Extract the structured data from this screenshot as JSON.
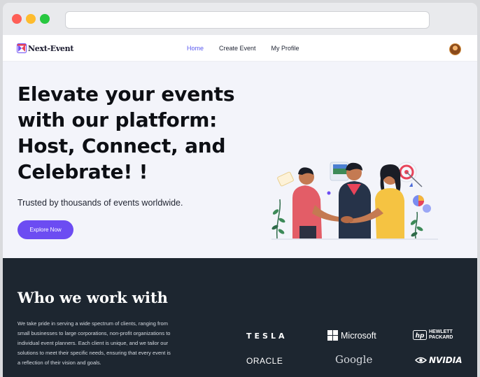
{
  "app": {
    "logo_text": "Next-Event"
  },
  "nav": {
    "items": [
      {
        "label": "Home",
        "active": true
      },
      {
        "label": "Create Event",
        "active": false
      },
      {
        "label": "My Profile",
        "active": false
      }
    ]
  },
  "hero": {
    "title": "Elevate your events with our platform: Host, Connect, and Celebrate! !",
    "subtitle": "Trusted by thousands of events worldwide.",
    "cta_label": "Explore Now"
  },
  "partners": {
    "title": "Who we work with",
    "description": "We take pride in serving a wide spectrum of clients, ranging from small businesses to large corporations, non-profit organizations to individual event planners. Each client is unique, and we tailor our solutions to meet their specific needs, ensuring that every event is a reflection of their vision and goals.",
    "brands": {
      "tesla": "TESLA",
      "microsoft": "Microsoft",
      "hp_line1": "HEWLETT",
      "hp_line2": "PACKARD",
      "oracle": "ORACLE",
      "google": "Google",
      "nvidia": "NVIDIA"
    }
  },
  "colors": {
    "accent": "#6c4cf2",
    "nav_active": "#5b5bf0",
    "dark_section": "#1d2630",
    "hero_bg": "#f3f4fa"
  },
  "icons": {
    "logo": "next-event-logo-icon",
    "avatar": "user-avatar",
    "illustration": "handshake-people-illustration"
  }
}
